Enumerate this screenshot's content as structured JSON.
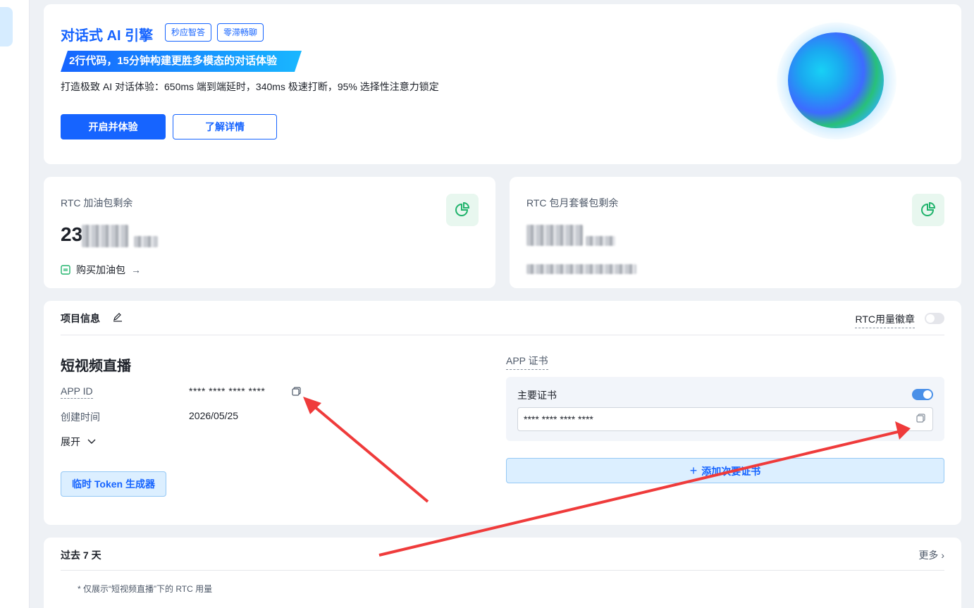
{
  "hero": {
    "title": "对话式 AI 引擎",
    "tags": [
      "秒应智答",
      "零滞畅聊"
    ],
    "banner": "2行代码，15分钟构建更胜多模态的对话体验",
    "description": "打造极致 AI 对话体验：650ms 端到端延时，340ms 极速打断，95% 选择性注意力锁定",
    "primary_button": "开启并体验",
    "secondary_button": "了解详情"
  },
  "stats": [
    {
      "label": "RTC 加油包剩余",
      "value_prefix": "23",
      "link": "购买加油包"
    },
    {
      "label": "RTC 包月套餐包剩余"
    }
  ],
  "project": {
    "header": "项目信息",
    "badge_label": "RTC用量徽章",
    "name": "短视频直播",
    "app_id_label": "APP ID",
    "app_id_value": "**** **** **** ****",
    "created_label": "创建时间",
    "created_value": "2026/05/25",
    "expand_label": "展开",
    "token_button": "临时 Token 生成器",
    "cert_section_label": "APP 证书",
    "primary_cert_label": "主要证书",
    "primary_cert_value": "**** **** **** ****",
    "add_cert_button": "添加次要证书"
  },
  "recent": {
    "title": "过去 7 天",
    "more": "更多",
    "note": "* 仅展示“短视频直播”下的 RTC 用量"
  },
  "colors": {
    "accent": "#1664ff",
    "green_icon": "#20b36c",
    "annotation_arrow": "#ef3b3b"
  }
}
